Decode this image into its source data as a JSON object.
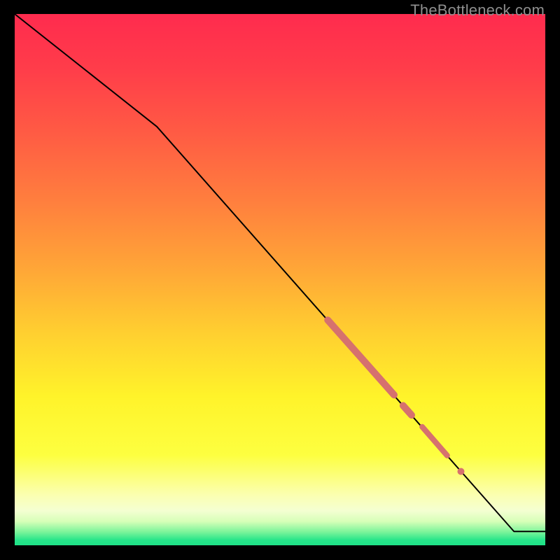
{
  "watermark": "TheBottleneck.com",
  "colors": {
    "line": "#000000",
    "marker": "#d6716e"
  },
  "chart_data": {
    "type": "line",
    "title": "",
    "xlabel": "",
    "ylabel": "",
    "xlim": [
      0,
      100
    ],
    "ylim": [
      0,
      100
    ],
    "grid": false,
    "axes_visible": false,
    "line_points": [
      {
        "x": 0.0,
        "y": 100.0
      },
      {
        "x": 26.8,
        "y": 78.8
      },
      {
        "x": 94.1,
        "y": 2.6
      },
      {
        "x": 100.0,
        "y": 2.6
      }
    ],
    "highlight_segments": [
      {
        "x1": 59.0,
        "y1": 42.4,
        "x2": 71.5,
        "y2": 28.3,
        "w": 10
      },
      {
        "x1": 73.2,
        "y1": 26.3,
        "x2": 74.8,
        "y2": 24.5,
        "w": 10
      },
      {
        "x1": 76.8,
        "y1": 22.3,
        "x2": 81.5,
        "y2": 16.9,
        "w": 8
      }
    ],
    "highlight_dots": [
      {
        "x": 84.1,
        "y": 13.9,
        "r": 5
      }
    ]
  }
}
